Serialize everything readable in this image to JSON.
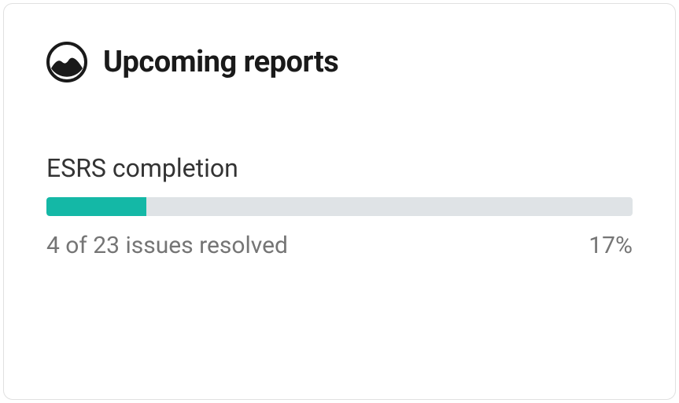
{
  "card": {
    "title": "Upcoming reports",
    "section": {
      "label": "ESRS completion",
      "progress_percent": 17,
      "progress_text": "4 of 23 issues resolved",
      "progress_percent_label": "17%"
    }
  }
}
